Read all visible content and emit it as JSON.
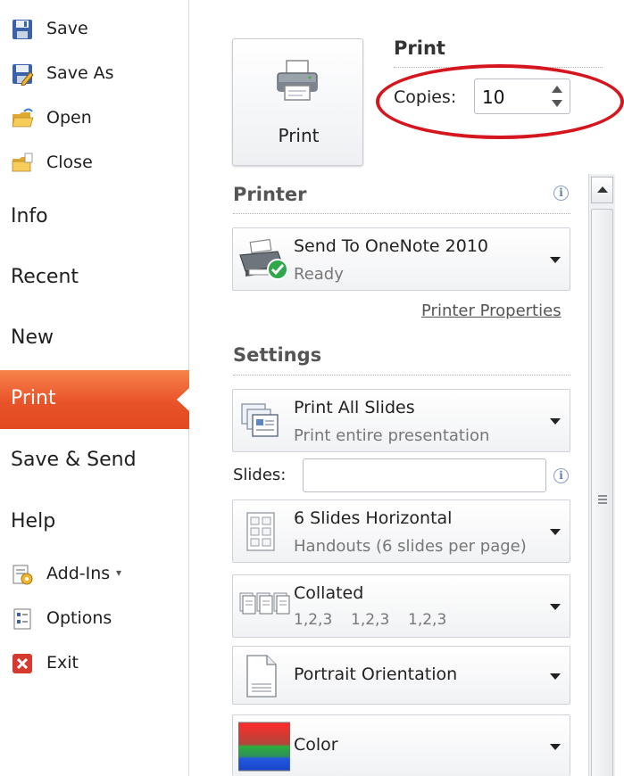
{
  "nav": {
    "commands": [
      {
        "label": "Save",
        "icon": "save-icon"
      },
      {
        "label": "Save As",
        "icon": "save-as-icon"
      },
      {
        "label": "Open",
        "icon": "open-folder-icon"
      },
      {
        "label": "Close",
        "icon": "close-folder-icon"
      }
    ],
    "tabs": {
      "info": "Info",
      "recent": "Recent",
      "new": "New",
      "print": "Print",
      "save_send": "Save & Send",
      "help": "Help"
    },
    "bottom": [
      {
        "label": "Add-Ins",
        "icon": "add-ins-icon",
        "suffix": "▾"
      },
      {
        "label": "Options",
        "icon": "options-icon"
      },
      {
        "label": "Exit",
        "icon": "exit-icon"
      }
    ],
    "selected_color": "#e8532a"
  },
  "print": {
    "button_label": "Print",
    "title": "Print",
    "copies_label": "Copies:",
    "copies_value": "10",
    "highlight_color": "#d5161f"
  },
  "printer": {
    "section_title": "Printer",
    "name": "Send To OneNote 2010",
    "status": "Ready",
    "properties_link": "Printer Properties"
  },
  "settings": {
    "section_title": "Settings",
    "print_range": {
      "title": "Print All Slides",
      "subtitle": "Print entire presentation"
    },
    "slides_label": "Slides:",
    "slides_value": "",
    "layout": {
      "title": "6 Slides Horizontal",
      "subtitle": "Handouts (6 slides per page)"
    },
    "collation": {
      "title": "Collated",
      "sequence": [
        "1,2,3",
        "1,2,3",
        "1,2,3"
      ]
    },
    "orientation": {
      "title": "Portrait Orientation"
    },
    "color": {
      "title": "Color"
    }
  }
}
